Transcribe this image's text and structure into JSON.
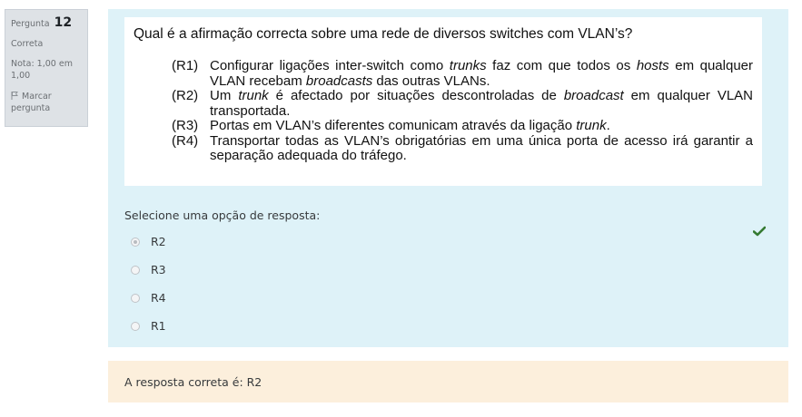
{
  "question_info": {
    "label": "Pergunta",
    "number": "12",
    "state": "Correta",
    "grade": "Nota: 1,00 em 1,00",
    "flag_label": "Marcar pergunta"
  },
  "question": {
    "stem": "Qual é a afirmação correcta sobre uma rede de diversos switches com VLAN’s?",
    "options": [
      {
        "label": "(R1)",
        "segments": [
          {
            "t": "Configurar ligações inter-switch como ",
            "i": false
          },
          {
            "t": "trunks",
            "i": true
          },
          {
            "t": " faz com que todos os ",
            "i": false
          },
          {
            "t": "hosts",
            "i": true
          },
          {
            "t": " em qualquer VLAN recebam ",
            "i": false
          },
          {
            "t": "broadcasts",
            "i": true
          },
          {
            "t": " das outras VLANs.",
            "i": false
          }
        ]
      },
      {
        "label": "(R2)",
        "segments": [
          {
            "t": "Um ",
            "i": false
          },
          {
            "t": "trunk",
            "i": true
          },
          {
            "t": " é afectado por situações descontroladas de ",
            "i": false
          },
          {
            "t": "broadcast",
            "i": true
          },
          {
            "t": " em qualquer VLAN transportada.",
            "i": false
          }
        ]
      },
      {
        "label": "(R3)",
        "segments": [
          {
            "t": "Portas em VLAN’s diferentes comunicam através da ligação ",
            "i": false
          },
          {
            "t": "trunk",
            "i": true
          },
          {
            "t": ".",
            "i": false
          }
        ]
      },
      {
        "label": "(R4)",
        "segments": [
          {
            "t": "Transportar todas as VLAN’s obrigatórias em uma única porta de acesso irá garantir a separação adequada do tráfego.",
            "i": false
          }
        ]
      }
    ]
  },
  "answer_prompt": "Selecione uma opção de resposta:",
  "answers": [
    {
      "label": "R2",
      "checked": true
    },
    {
      "label": "R3",
      "checked": false
    },
    {
      "label": "R4",
      "checked": false
    },
    {
      "label": "R1",
      "checked": false
    }
  ],
  "status_icon": "check-icon",
  "colors": {
    "check": "#357a32",
    "formulation_bg": "#def2f8",
    "feedback_bg": "#fcefdc",
    "info_bg": "#dee2e6"
  },
  "feedback": {
    "right_answer": "A resposta correta é: R2"
  }
}
